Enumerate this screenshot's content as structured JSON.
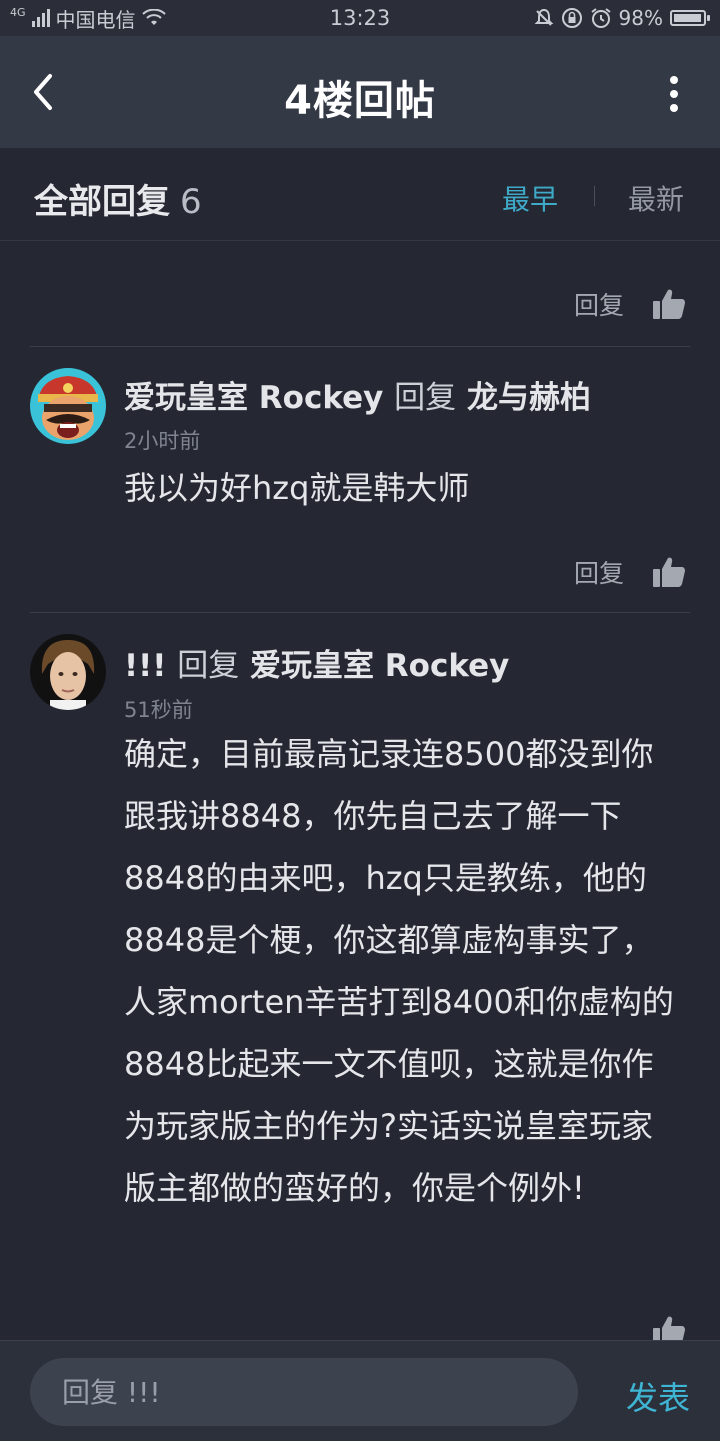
{
  "status_bar": {
    "network": "4G",
    "carrier": "中国电信",
    "time": "13:23",
    "battery": "98%",
    "battery_level": 0.98
  },
  "header": {
    "title": "4楼回帖"
  },
  "filter": {
    "all_label": "全部回复",
    "count": "6",
    "sort_earliest": "最早",
    "sort_latest": "最新"
  },
  "actions": {
    "reply_label": "回复"
  },
  "comments": [
    {
      "author": "爱玩皇室 Rockey",
      "verb": "回复",
      "target": "龙与赫柏",
      "time": "2小时前",
      "text": "我以为好hzq就是韩大师"
    },
    {
      "author": "!!!",
      "verb": "回复",
      "target": "爱玩皇室 Rockey",
      "time": "51秒前",
      "text": "确定，目前最高记录连8500都没到你跟我讲8848，你先自己去了解一下8848的由来吧，hzq只是教练，他的8848是个梗，你这都算虚构事实了，人家morten辛苦打到8400和你虚构的8848比起来一文不值呗，这就是你作为玩家版主的作为?实话实说皇室玩家版主都做的蛮好的，你是个例外!"
    }
  ],
  "bottom": {
    "input_placeholder": "回复 !!!",
    "send_label": "发表"
  },
  "colors": {
    "background": "#252833",
    "header": "#343946",
    "accent": "#3fa9c8"
  }
}
